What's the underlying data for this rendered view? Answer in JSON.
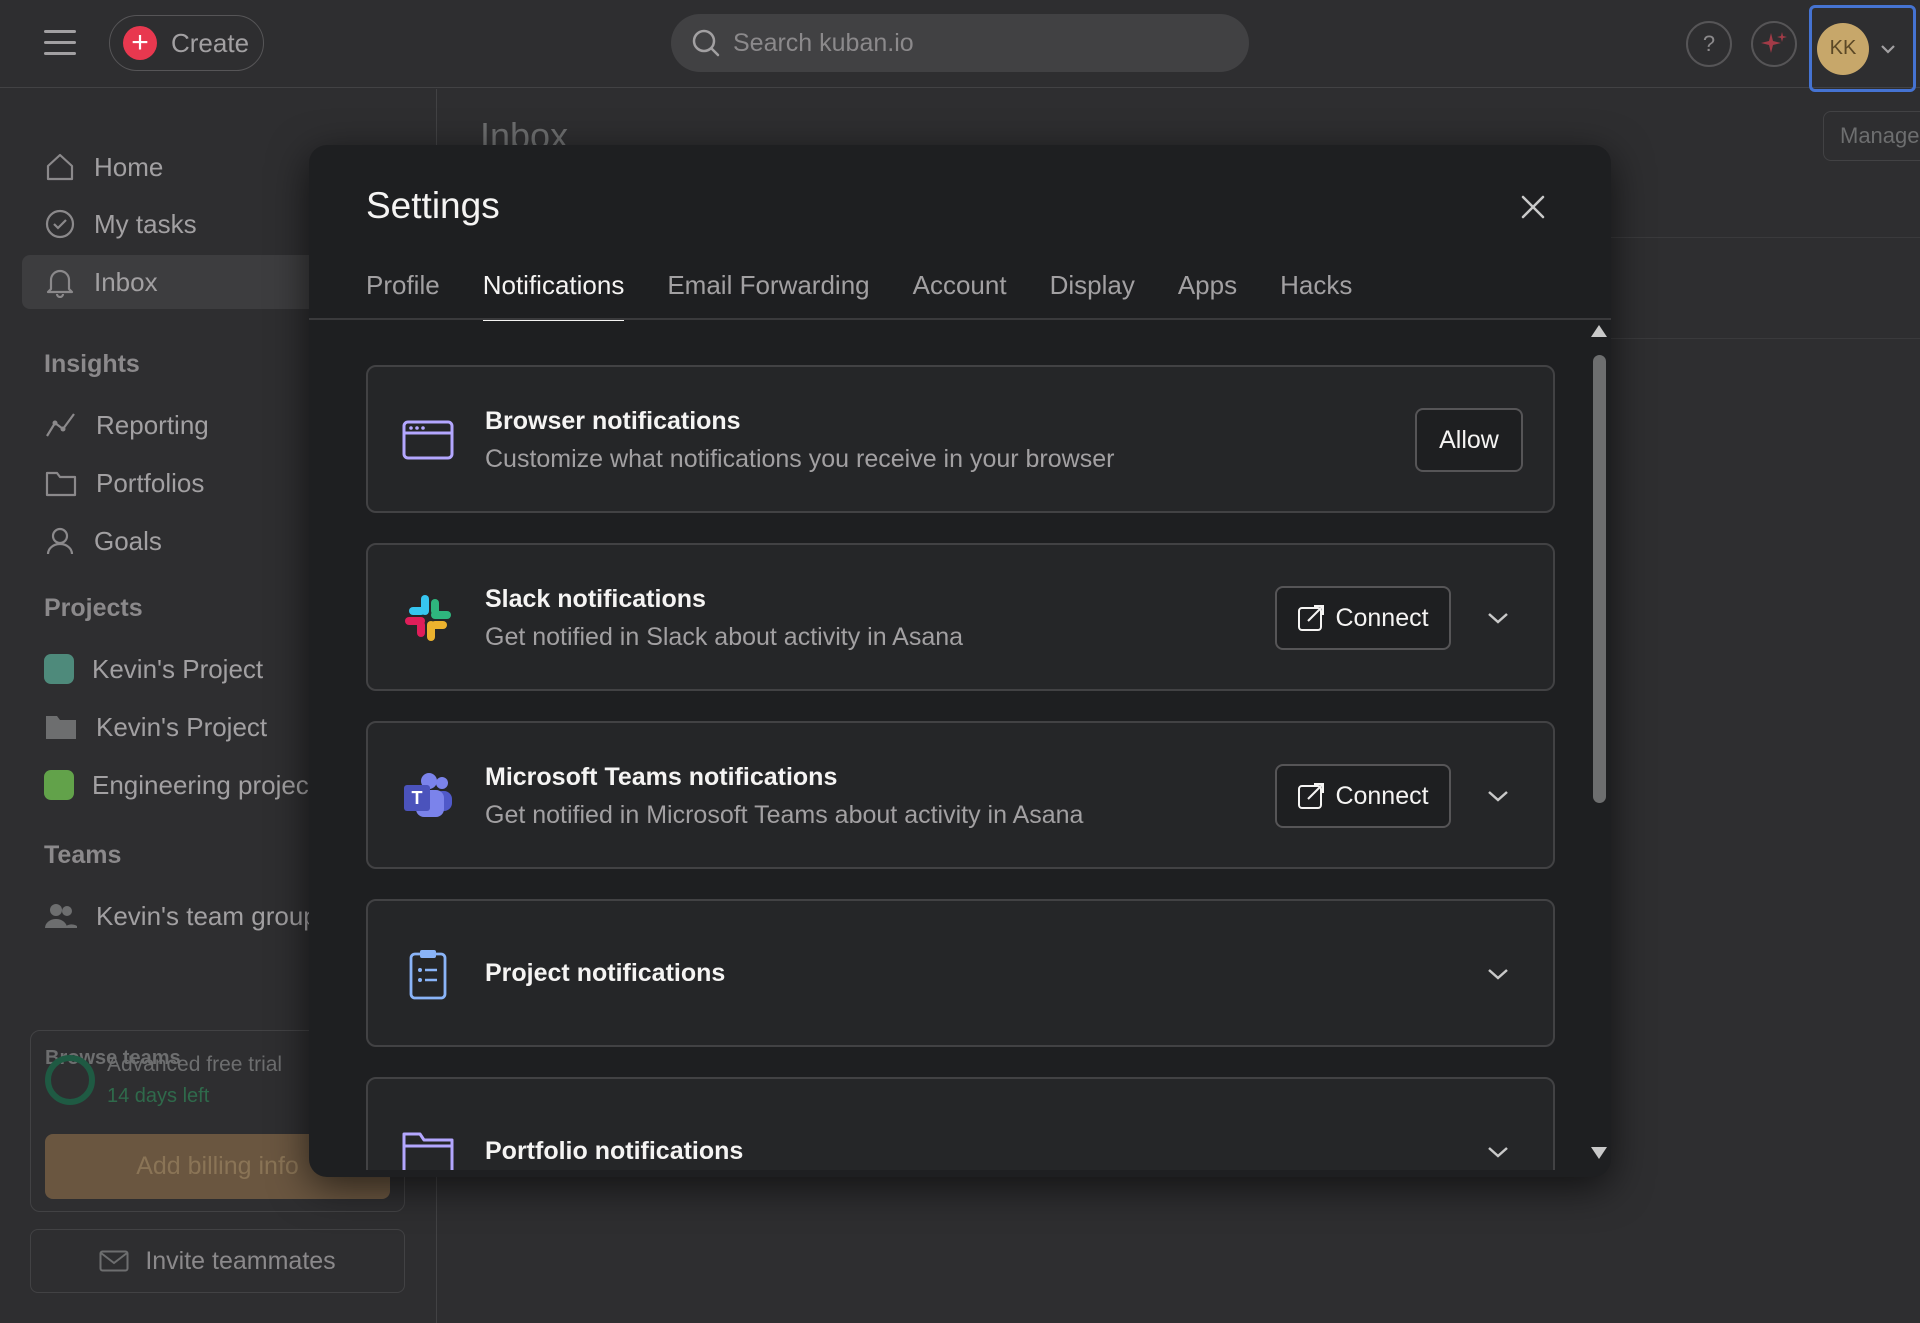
{
  "topbar": {
    "create_label": "Create",
    "search_placeholder": "Search kuban.io",
    "help_label": "?",
    "avatar_initials": "KK"
  },
  "sidebar": {
    "nav": [
      {
        "label": "Home",
        "icon": "home-icon"
      },
      {
        "label": "My tasks",
        "icon": "check-circle-icon"
      },
      {
        "label": "Inbox",
        "icon": "bell-icon"
      }
    ],
    "insights_title": "Insights",
    "insights": [
      {
        "label": "Reporting",
        "icon": "chart-line-icon"
      },
      {
        "label": "Portfolios",
        "icon": "folder-icon"
      },
      {
        "label": "Goals",
        "icon": "person-icon"
      }
    ],
    "projects_title": "Projects",
    "projects": [
      {
        "label": "Kevin's Project",
        "color": "#4e8a7b"
      },
      {
        "label": "Kevin's Project",
        "color": "#6d6e6f"
      },
      {
        "label": "Engineering project",
        "color": "#62a24a"
      }
    ],
    "teams_title": "Teams",
    "team_name": "Kevin's team group",
    "browse_teams": "Browse teams",
    "trial_title": "Advanced free trial",
    "trial_days": "14 days left",
    "billing_button": "Add billing info",
    "invite_button": "Invite teammates"
  },
  "main": {
    "title": "Inbox",
    "manage_button": "Manage"
  },
  "modal": {
    "title": "Settings",
    "tabs": [
      "Profile",
      "Notifications",
      "Email Forwarding",
      "Account",
      "Display",
      "Apps",
      "Hacks"
    ],
    "active_tab": "Notifications",
    "cards": [
      {
        "title": "Browser notifications",
        "desc": "Customize what notifications you receive in your browser",
        "button": "Allow",
        "icon": "browser-window-icon"
      },
      {
        "title": "Slack notifications",
        "desc": "Get notified in Slack about activity in Asana",
        "button": "Connect",
        "icon": "slack-icon"
      },
      {
        "title": "Microsoft Teams notifications",
        "desc": "Get notified in Microsoft Teams about activity in Asana",
        "button": "Connect",
        "icon": "teams-icon"
      },
      {
        "title": "Project notifications",
        "icon": "clipboard-icon"
      },
      {
        "title": "Portfolio notifications",
        "icon": "folder-icon"
      }
    ]
  },
  "colors": {
    "accent_red": "#e8384f",
    "focus_blue": "#4573d2",
    "icon_purple": "#b4a7ff"
  }
}
